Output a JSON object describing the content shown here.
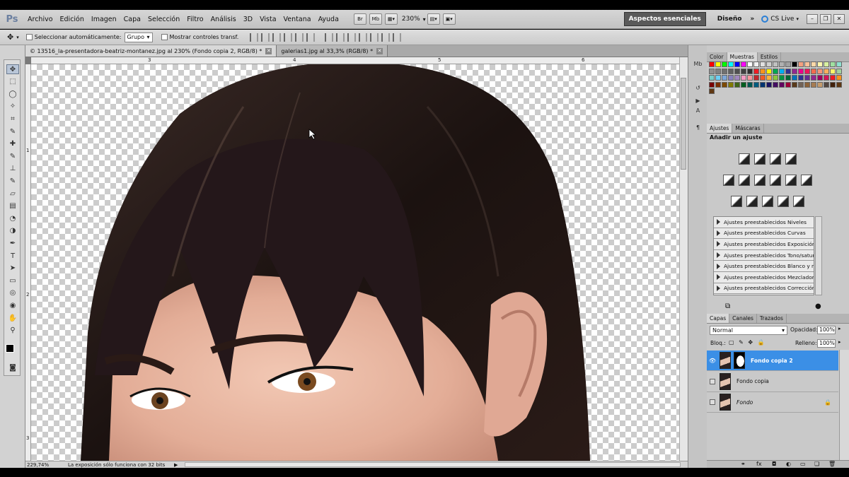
{
  "app": {
    "logo": "Ps"
  },
  "menu": [
    "Archivo",
    "Edición",
    "Imagen",
    "Capa",
    "Selección",
    "Filtro",
    "Análisis",
    "3D",
    "Vista",
    "Ventana",
    "Ayuda"
  ],
  "menubar": {
    "bridge_label": "Br",
    "minibridge_label": "Mb",
    "zoom": "230%",
    "workspace_active": "Aspectos esenciales",
    "workspace_other": "Diseño",
    "more": "»",
    "cs_live": "CS Live"
  },
  "options": {
    "auto_select_label": "Seleccionar automáticamente:",
    "auto_select_value": "Grupo",
    "show_transform_label": "Mostrar controles transf."
  },
  "tabs": [
    {
      "label": "© 13516_la-presentadora-beatriz-montanez.jpg al 230% (Fondo copia 2, RGB/8) *",
      "active": true
    },
    {
      "label": "galerias1.jpg al 33,3% (RGB/8) *",
      "active": false
    }
  ],
  "rulers": {
    "h": [
      "3",
      "4",
      "5",
      "6"
    ],
    "v": [
      "1",
      "2",
      "3"
    ]
  },
  "status": {
    "zoom": "229,74%",
    "message": "La exposición sólo funciona con 32 bits"
  },
  "color_panel": {
    "tabs": [
      "Color",
      "Muestras",
      "Estilos"
    ],
    "active_tab": "Muestras",
    "swatch_rows": [
      [
        "#ff0000",
        "#ffff00",
        "#00ff00",
        "#00ffff",
        "#0000ff",
        "#ff00ff",
        "#ffffff",
        "#f0f0f0",
        "#e0e0e0",
        "#d0d0d0",
        "#c0c0c0",
        "#b0b0b0",
        "#a0a0a0",
        "#000000",
        "#f4a080",
        "#f8c098",
        "#fcd8a8",
        "#fff8b0",
        "#d8f0a0",
        "#a0e0a0",
        "#90e0d0"
      ],
      [
        "#909090",
        "#808080",
        "#707070",
        "#606060",
        "#505050",
        "#404040",
        "#303030",
        "#ee1c24",
        "#f7941d",
        "#fff200",
        "#00a651",
        "#00aeef",
        "#2e3192",
        "#92278f",
        "#ec008c",
        "#ed145b",
        "#f26c4f",
        "#f69679",
        "#fbaf5d",
        "#fff568",
        "#a3d39c"
      ],
      [
        "#7accc8",
        "#6dcff6",
        "#7da7d9",
        "#8781bd",
        "#a187be",
        "#f49ac2",
        "#f6989d",
        "#c1272d",
        "#f15a24",
        "#fbb03b",
        "#8cc63f",
        "#009245",
        "#006837",
        "#0071bc",
        "#2e3192",
        "#662d91",
        "#93278f",
        "#9e005d",
        "#d4145a",
        "#ed1c24",
        "#f7931e"
      ],
      [
        "#790000",
        "#7b2e00",
        "#7d4900",
        "#827b00",
        "#406618",
        "#005e20",
        "#005952",
        "#005b7f",
        "#003471",
        "#1b1464",
        "#440e62",
        "#630460",
        "#9e0039",
        "#5a3a1a",
        "#736357",
        "#8c6239",
        "#a67c52",
        "#c69c6d",
        "#534741",
        "#42210b",
        "#603813"
      ],
      [
        "#603813"
      ]
    ]
  },
  "adjustments": {
    "tabs": [
      "Ajustes",
      "Máscaras"
    ],
    "title": "Añadir un ajuste",
    "presets": [
      "Ajustes preestablecidos Niveles",
      "Ajustes preestablecidos Curvas",
      "Ajustes preestablecidos Exposición",
      "Ajustes preestablecidos Tono/satur...",
      "Ajustes preestablecidos Blanco y ne...",
      "Ajustes preestablecidos Mezclador ...",
      "Ajustes preestablecidos Corrección ..."
    ]
  },
  "layers": {
    "tabs": [
      "Capas",
      "Canales",
      "Trazados"
    ],
    "blend_mode": "Normal",
    "opacity_label": "Opacidad:",
    "opacity": "100%",
    "lock_label": "Bloq.:",
    "fill_label": "Relleno:",
    "fill": "100%",
    "items": [
      {
        "name": "Fondo copia 2",
        "selected": true,
        "has_mask": true,
        "visible": true
      },
      {
        "name": "Fondo copia",
        "selected": false,
        "has_mask": false,
        "visible": false
      },
      {
        "name": "Fondo",
        "selected": false,
        "has_mask": false,
        "visible": false,
        "italic": true,
        "locked": true
      }
    ]
  }
}
